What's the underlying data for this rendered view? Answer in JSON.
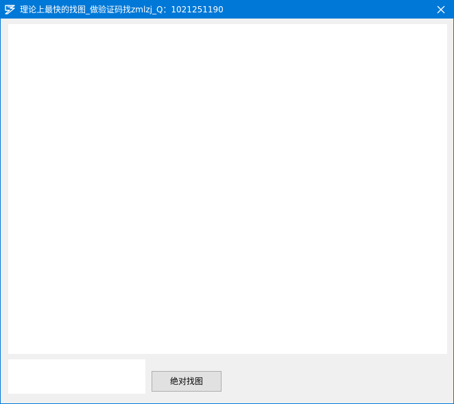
{
  "window": {
    "title": "理论上最快的找图_做验证码找zmlzj_Q：1021251190",
    "app_icon": "app-logo-icon",
    "close_icon": "close-icon",
    "colors": {
      "titlebar": "#0078d7",
      "background": "#f0f0f0",
      "panel": "#ffffff",
      "button": "#e1e1e1"
    }
  },
  "controls": {
    "find_button_label": "绝对找图"
  }
}
